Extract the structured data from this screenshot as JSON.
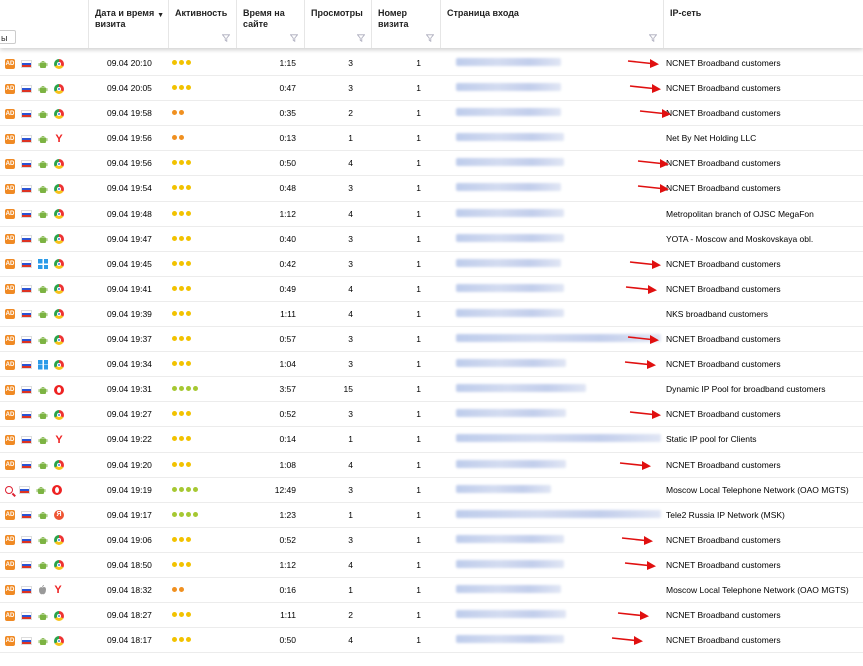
{
  "header": {
    "search_fragment": "ы",
    "columns": [
      {
        "label": "Дата и время визита",
        "sort": "▼"
      },
      {
        "label": "Активность"
      },
      {
        "label": "Время на сайте"
      },
      {
        "label": "Просмотры"
      },
      {
        "label": "Номер визита"
      },
      {
        "label": "Страница входа"
      },
      {
        "label": "IP-сеть"
      }
    ]
  },
  "colors": {
    "activity_yellow": "#f2c200",
    "activity_orange": "#f09020",
    "activity_green": "#a6c832",
    "arrow_red": "#e01010"
  },
  "rows": [
    {
      "src": "ad",
      "os": "android",
      "browser": "chrome",
      "date": "09.04 20:10",
      "act": 3,
      "act_color": "yellow",
      "time": "1:15",
      "views": "3",
      "num": "1",
      "ip": "NCNET Broadband customers",
      "arrow": true
    },
    {
      "src": "ad",
      "os": "android",
      "browser": "chrome",
      "date": "09.04 20:05",
      "act": 3,
      "act_color": "yellow",
      "time": "0:47",
      "views": "3",
      "num": "1",
      "ip": "NCNET Broadband customers",
      "arrow": true
    },
    {
      "src": "ad",
      "os": "android",
      "browser": "chrome",
      "date": "09.04 19:58",
      "act": 2,
      "act_color": "orange",
      "time": "0:35",
      "views": "2",
      "num": "1",
      "ip": "NCNET Broadband customers",
      "arrow": true
    },
    {
      "src": "ad",
      "os": "android",
      "browser": "yandex",
      "date": "09.04 19:56",
      "act": 2,
      "act_color": "orange",
      "time": "0:13",
      "views": "1",
      "num": "1",
      "ip": "Net By Net Holding LLC",
      "arrow": false
    },
    {
      "src": "ad",
      "os": "android",
      "browser": "chrome",
      "date": "09.04 19:56",
      "act": 3,
      "act_color": "yellow",
      "time": "0:50",
      "views": "4",
      "num": "1",
      "ip": "NCNET Broadband customers",
      "arrow": true
    },
    {
      "src": "ad",
      "os": "android",
      "browser": "chrome",
      "date": "09.04 19:54",
      "act": 3,
      "act_color": "yellow",
      "time": "0:48",
      "views": "3",
      "num": "1",
      "ip": "NCNET Broadband customers",
      "arrow": true
    },
    {
      "src": "ad",
      "os": "android",
      "browser": "chrome",
      "date": "09.04 19:48",
      "act": 3,
      "act_color": "yellow",
      "time": "1:12",
      "views": "4",
      "num": "1",
      "ip": "Metropolitan branch of OJSC MegaFon",
      "arrow": false
    },
    {
      "src": "ad",
      "os": "android",
      "browser": "chrome",
      "date": "09.04 19:47",
      "act": 3,
      "act_color": "yellow",
      "time": "0:40",
      "views": "3",
      "num": "1",
      "ip": "YOTA - Moscow and Moskovskaya obl.",
      "arrow": false
    },
    {
      "src": "ad",
      "os": "windows",
      "browser": "chrome",
      "date": "09.04 19:45",
      "act": 3,
      "act_color": "yellow",
      "time": "0:42",
      "views": "3",
      "num": "1",
      "ip": "NCNET Broadband customers",
      "arrow": true
    },
    {
      "src": "ad",
      "os": "android",
      "browser": "chrome",
      "date": "09.04 19:41",
      "act": 3,
      "act_color": "yellow",
      "time": "0:49",
      "views": "4",
      "num": "1",
      "ip": "NCNET Broadband customers",
      "arrow": true
    },
    {
      "src": "ad",
      "os": "android",
      "browser": "chrome",
      "date": "09.04 19:39",
      "act": 3,
      "act_color": "yellow",
      "time": "1:11",
      "views": "4",
      "num": "1",
      "ip": "NKS broadband customers",
      "arrow": false
    },
    {
      "src": "ad",
      "os": "android",
      "browser": "chrome",
      "date": "09.04 19:37",
      "act": 3,
      "act_color": "yellow",
      "time": "0:57",
      "views": "3",
      "num": "1",
      "ip": "NCNET Broadband customers",
      "arrow": true
    },
    {
      "src": "ad",
      "os": "windows",
      "browser": "chrome",
      "date": "09.04 19:34",
      "act": 3,
      "act_color": "yellow",
      "time": "1:04",
      "views": "3",
      "num": "1",
      "ip": "NCNET Broadband customers",
      "arrow": true
    },
    {
      "src": "ad",
      "os": "android",
      "browser": "opera",
      "date": "09.04 19:31",
      "act": 4,
      "act_color": "green",
      "time": "3:57",
      "views": "15",
      "num": "1",
      "ip": "Dynamic IP Pool for broadband customers",
      "arrow": false
    },
    {
      "src": "ad",
      "os": "android",
      "browser": "chrome",
      "date": "09.04 19:27",
      "act": 3,
      "act_color": "yellow",
      "time": "0:52",
      "views": "3",
      "num": "1",
      "ip": "NCNET Broadband customers",
      "arrow": true
    },
    {
      "src": "ad",
      "os": "android",
      "browser": "yandex",
      "date": "09.04 19:22",
      "act": 3,
      "act_color": "yellow",
      "time": "0:14",
      "views": "1",
      "num": "1",
      "ip": "Static IP pool for Clients",
      "arrow": false
    },
    {
      "src": "ad",
      "os": "android",
      "browser": "chrome",
      "date": "09.04 19:20",
      "act": 3,
      "act_color": "yellow",
      "time": "1:08",
      "views": "4",
      "num": "1",
      "ip": "NCNET Broadband customers",
      "arrow": true
    },
    {
      "src": "search",
      "os": "android",
      "browser": "opera",
      "date": "09.04 19:19",
      "act": 4,
      "act_color": "green",
      "time": "12:49",
      "views": "3",
      "num": "1",
      "ip": "Moscow Local Telephone Network (OAO MGTS)",
      "arrow": false
    },
    {
      "src": "ad",
      "os": "android",
      "browser": "ybrowser",
      "date": "09.04 19:17",
      "act": 4,
      "act_color": "green",
      "time": "1:23",
      "views": "1",
      "num": "1",
      "ip": "Tele2 Russia IP Network (MSK)",
      "arrow": false
    },
    {
      "src": "ad",
      "os": "android",
      "browser": "chrome",
      "date": "09.04 19:06",
      "act": 3,
      "act_color": "yellow",
      "time": "0:52",
      "views": "3",
      "num": "1",
      "ip": "NCNET Broadband customers",
      "arrow": true
    },
    {
      "src": "ad",
      "os": "android",
      "browser": "chrome",
      "date": "09.04 18:50",
      "act": 3,
      "act_color": "yellow",
      "time": "1:12",
      "views": "4",
      "num": "1",
      "ip": "NCNET Broadband customers",
      "arrow": true
    },
    {
      "src": "ad",
      "os": "apple",
      "browser": "yandex",
      "date": "09.04 18:32",
      "act": 2,
      "act_color": "orange",
      "time": "0:16",
      "views": "1",
      "num": "1",
      "ip": "Moscow Local Telephone Network (OAO MGTS)",
      "arrow": false
    },
    {
      "src": "ad",
      "os": "android",
      "browser": "chrome",
      "date": "09.04 18:27",
      "act": 3,
      "act_color": "yellow",
      "time": "1:11",
      "views": "2",
      "num": "1",
      "ip": "NCNET Broadband customers",
      "arrow": true
    },
    {
      "src": "ad",
      "os": "android",
      "browser": "chrome",
      "date": "09.04 18:17",
      "act": 3,
      "act_color": "yellow",
      "time": "0:50",
      "views": "4",
      "num": "1",
      "ip": "NCNET Broadband customers",
      "arrow": true
    }
  ]
}
